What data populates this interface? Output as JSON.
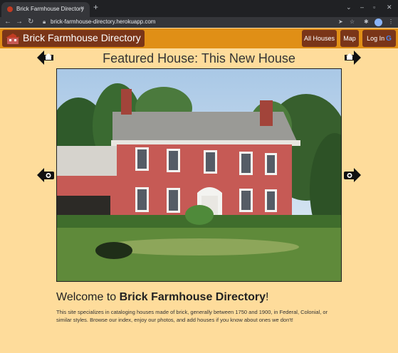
{
  "browser": {
    "tab_title": "Brick Farmhouse Directory",
    "tab_close": "×",
    "new_tab": "+",
    "url": "brick-farmhouse-directory.herokuapp.com"
  },
  "navbar": {
    "brand": "Brick Farmhouse Directory",
    "links": {
      "all_houses": "All Houses",
      "map": "Map",
      "login": "Log In",
      "login_icon": "G"
    }
  },
  "featured": {
    "title": "Featured House: This New House"
  },
  "welcome": {
    "prefix": "Welcome to ",
    "brand": "Brick Farmhouse Directory",
    "suffix": "!",
    "blurb": "This site specializes in cataloging houses made of brick, generally between 1750 and 1900, in Federal, Colonial, or similar styles. Browse our index, enjoy our photos, and add houses if you know about ones we don't!"
  },
  "icons": {
    "prev_house": "house-left-arrow-icon",
    "next_house": "house-right-arrow-icon",
    "prev_photo": "camera-left-arrow-icon",
    "next_photo": "camera-right-arrow-icon"
  },
  "colors": {
    "page_bg": "#fedc9b",
    "navbar_bg": "#e08f16",
    "button_bg": "#7a3518",
    "brick": "#c65a55"
  }
}
